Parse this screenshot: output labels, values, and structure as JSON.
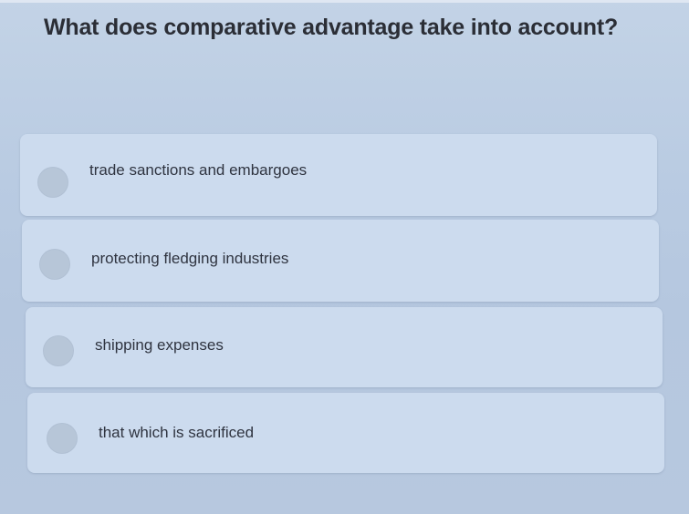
{
  "quiz": {
    "question": "What does comparative advantage take into account?",
    "options": [
      {
        "label": "trade sanctions and embargoes",
        "selected": false
      },
      {
        "label": "protecting fledging industries",
        "selected": false
      },
      {
        "label": "shipping expenses",
        "selected": false
      },
      {
        "label": "that which is sacrificed",
        "selected": false
      }
    ]
  },
  "colors": {
    "background": "#b9cbe2",
    "option_card": "#ccdbee",
    "radio": "#b7c6d8",
    "question_text": "#2b2e36",
    "option_text": "#2f3440"
  }
}
